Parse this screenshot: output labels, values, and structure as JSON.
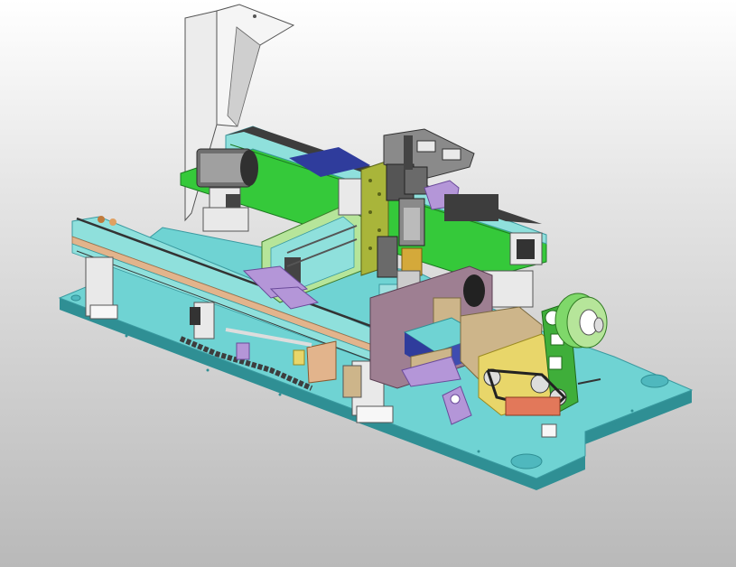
{
  "viewport": {
    "background_top": "#ffffff",
    "background_bottom": "#b9b9b9"
  },
  "model": {
    "palette": {
      "base_plate": "#6fd3d3",
      "base_plate_edge": "#2f8f94",
      "rail_green": "#35c93a",
      "rail_cyan": "#8fe0dc",
      "copper_strip": "#e2b48c",
      "grey_housing": "#8a8a8a",
      "dark_grey": "#3d3d3d",
      "panel_white": "#e9e9e9",
      "olive_plate": "#a9b53a",
      "purple_block": "#b496d8",
      "navy_block": "#2f3c9c",
      "mauve_plate": "#9e7f92",
      "tan_block": "#cdb58a",
      "feeder_green": "#3fae3a",
      "reel_green": "#7fd86a"
    },
    "icons": [
      "machine-base-plate",
      "gantry-rail",
      "servo-motor",
      "z-axis-actuator",
      "conveyor-belt",
      "tape-reel",
      "feeder-bracket"
    ]
  }
}
